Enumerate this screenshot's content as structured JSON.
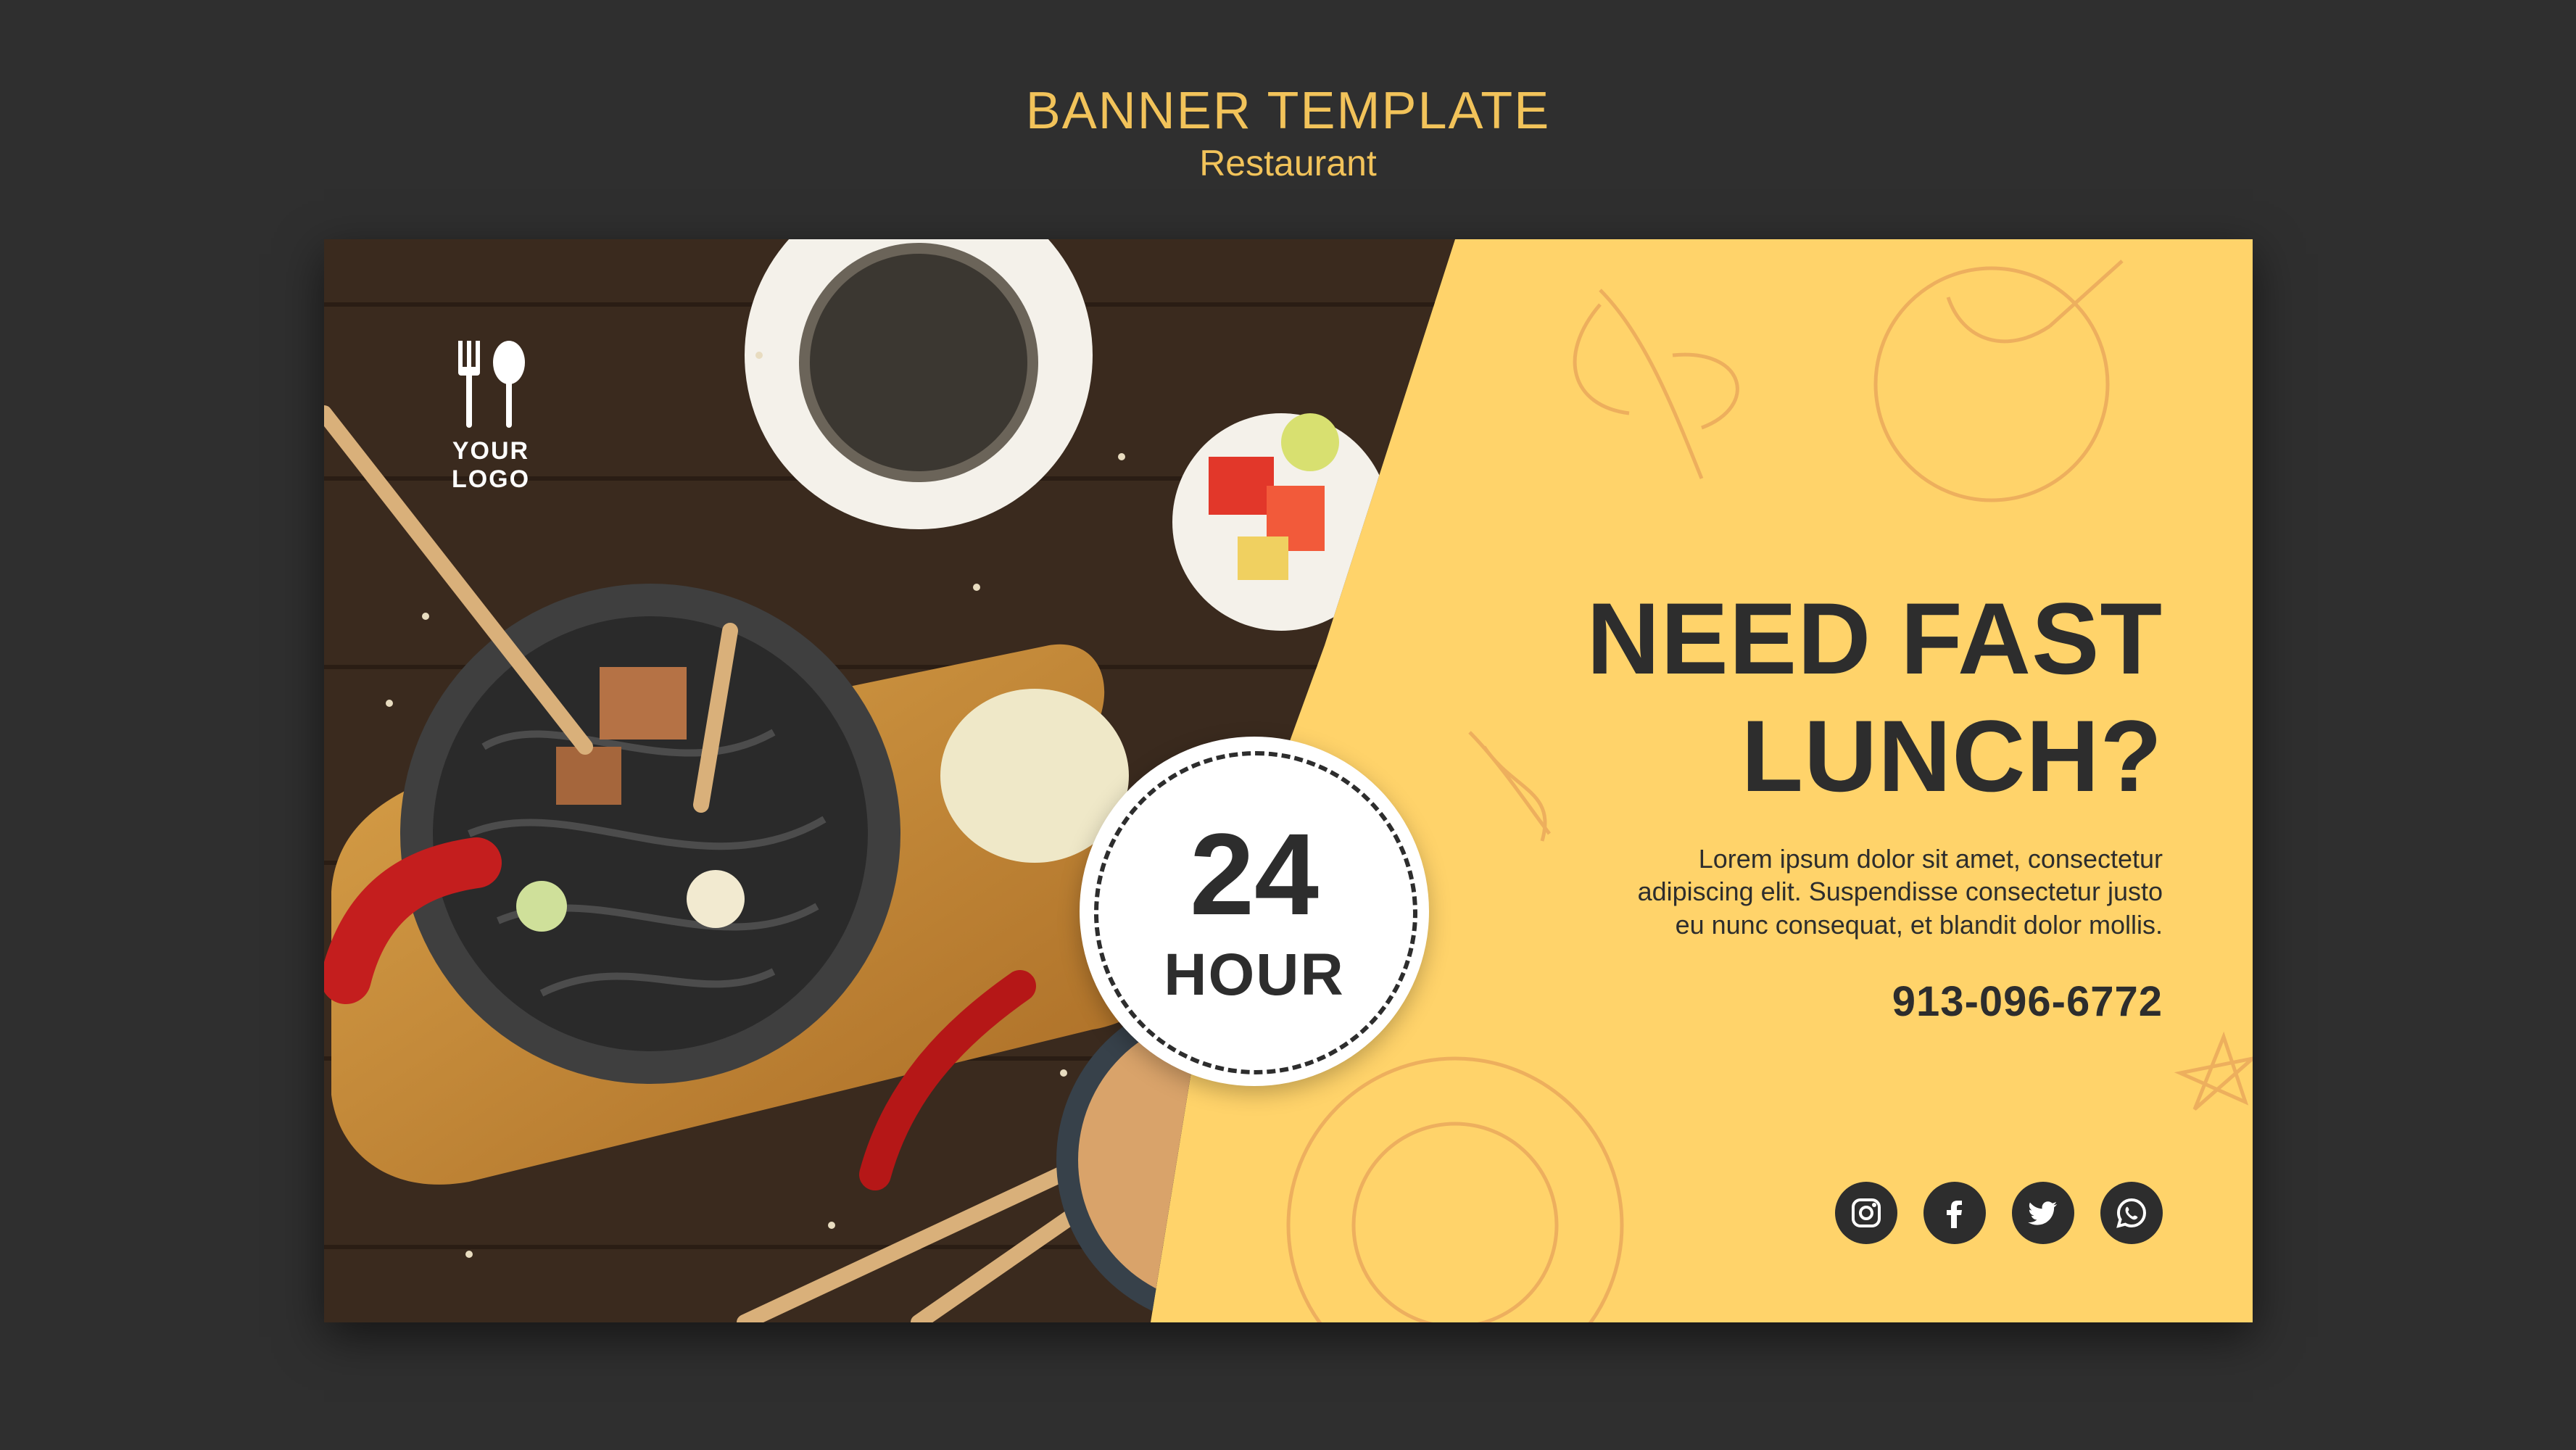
{
  "header": {
    "title": "BANNER TEMPLATE",
    "subtitle": "Restaurant"
  },
  "banner": {
    "logo_label": "YOUR LOGO",
    "badge": {
      "number": "24",
      "word": "HOUR"
    },
    "headline_line1": "NEED FAST",
    "headline_line2": "LUNCH?",
    "body_line1": "Lorem ipsum dolor sit amet, consectetur",
    "body_line2": "adipiscing elit. Suspendisse consectetur justo",
    "body_line3": "eu nunc consequat, et blandit dolor mollis.",
    "phone": "913-096-6772",
    "socials": [
      "instagram-icon",
      "facebook-icon",
      "twitter-icon",
      "whatsapp-icon"
    ]
  },
  "colors": {
    "background": "#2f2f2f",
    "accent_gold": "#f2c35a",
    "panel_yellow": "#ffd36a",
    "text_dark": "#2d2d2d"
  }
}
